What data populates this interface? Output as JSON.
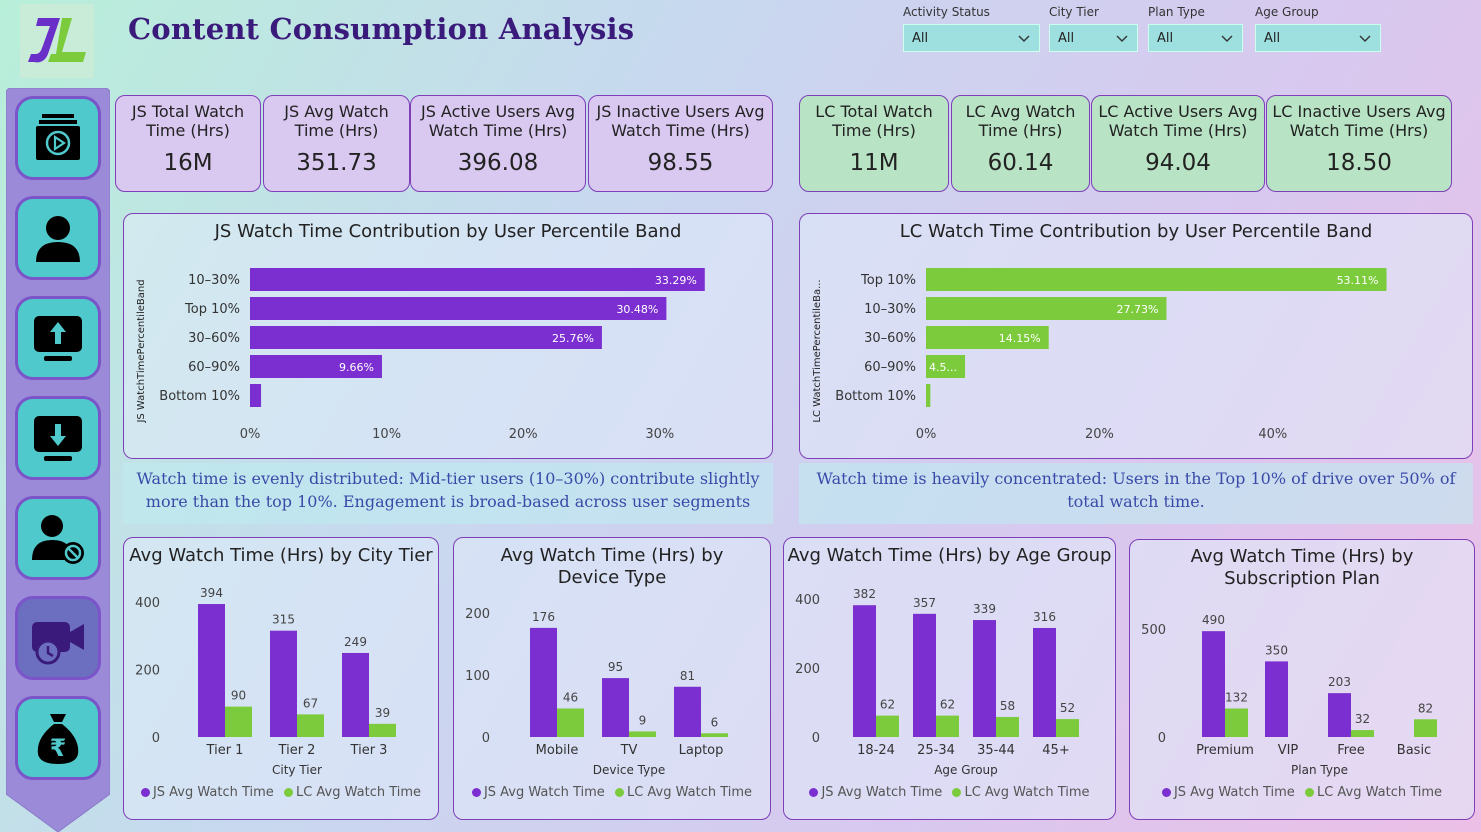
{
  "header": {
    "title": "Content Consumption Analysis",
    "logo_text": "JL"
  },
  "slicers": [
    {
      "label": "Activity Status",
      "value": "All"
    },
    {
      "label": "City Tier",
      "value": "All"
    },
    {
      "label": "Plan Type",
      "value": "All"
    },
    {
      "label": "Age Group",
      "value": "All"
    }
  ],
  "colors": {
    "js": "#7b2fd0",
    "lc": "#7ccb3c",
    "border": "#7e3fb8"
  },
  "sidebar": {
    "items": [
      {
        "icon": "content-play-icon"
      },
      {
        "icon": "user-icon"
      },
      {
        "icon": "upgrade-icon"
      },
      {
        "icon": "downgrade-icon"
      },
      {
        "icon": "inactive-user-icon"
      },
      {
        "icon": "watch-time-icon",
        "active": true
      },
      {
        "icon": "revenue-icon"
      }
    ]
  },
  "kpis_js": [
    {
      "title": "JS Total Watch Time (Hrs)",
      "value": "16M"
    },
    {
      "title": "JS Avg Watch Time (Hrs)",
      "value": "351.73"
    },
    {
      "title": "JS Active Users Avg Watch Time (Hrs)",
      "value": "396.08"
    },
    {
      "title": "JS Inactive Users Avg Watch Time (Hrs)",
      "value": "98.55"
    }
  ],
  "kpis_lc": [
    {
      "title": "LC Total Watch Time (Hrs)",
      "value": "11M"
    },
    {
      "title": "LC Avg Watch Time (Hrs)",
      "value": "60.14"
    },
    {
      "title": "LC Active Users Avg Watch Time (Hrs)",
      "value": "94.04"
    },
    {
      "title": "LC Inactive Users Avg Watch Time (Hrs)",
      "value": "18.50"
    }
  ],
  "notes": {
    "js": "Watch time is evenly distributed: Mid-tier users (10–30%) contribute slightly more than the top 10%. Engagement is broad-based across user segments",
    "lc": "Watch time is heavily concentrated: Users in the Top 10% of drive over 50% of total watch time."
  },
  "legend": {
    "js": "JS Avg Watch Time",
    "lc": "LC Avg Watch Time"
  },
  "chart_data": [
    {
      "type": "bar",
      "orientation": "horizontal",
      "title": "JS Watch Time Contribution by User Percentile Band",
      "ylabel": "JS WatchTimePercentileBand",
      "categories": [
        "10–30%",
        "Top 10%",
        "30–60%",
        "60–90%",
        "Bottom 10%"
      ],
      "values": [
        33.29,
        30.48,
        25.76,
        9.66,
        0.81
      ],
      "labels": [
        "33.29%",
        "30.48%",
        "25.76%",
        "9.66%",
        ""
      ],
      "xticks": [
        "0%",
        "10%",
        "20%",
        "30%"
      ],
      "xlim": [
        0,
        36.6
      ],
      "color": "#7b2fd0"
    },
    {
      "type": "bar",
      "orientation": "horizontal",
      "title": "LC Watch Time Contribution by User Percentile Band",
      "ylabel": "LC WatchTimePercentileBa...",
      "categories": [
        "Top 10%",
        "10–30%",
        "30–60%",
        "60–90%",
        "Bottom 10%"
      ],
      "values": [
        53.11,
        27.73,
        14.15,
        4.5,
        0.5
      ],
      "labels": [
        "53.11%",
        "27.73%",
        "14.15%",
        "4.5...",
        ""
      ],
      "xticks": [
        "0%",
        "20%",
        "40%"
      ],
      "xlim": [
        0,
        61.7
      ],
      "color": "#7ccb3c"
    },
    {
      "type": "bar",
      "title": "Avg Watch Time (Hrs) by City Tier",
      "xlabel": "City Tier",
      "categories": [
        "Tier 1",
        "Tier 2",
        "Tier 3"
      ],
      "series": [
        {
          "name": "JS Avg Watch Time",
          "values": [
            394,
            315,
            249
          ]
        },
        {
          "name": "LC Avg Watch Time",
          "values": [
            90,
            67,
            39
          ]
        }
      ],
      "yticks": [
        0,
        200,
        400
      ],
      "ylim": [
        0,
        400
      ]
    },
    {
      "type": "bar",
      "title": "Avg Watch Time (Hrs) by Device Type",
      "xlabel": "Device Type",
      "categories": [
        "Mobile",
        "TV",
        "Laptop"
      ],
      "series": [
        {
          "name": "JS Avg Watch Time",
          "values": [
            176,
            95,
            81
          ]
        },
        {
          "name": "LC Avg Watch Time",
          "values": [
            46,
            9,
            6
          ]
        }
      ],
      "yticks": [
        0,
        100,
        200
      ],
      "ylim": [
        0,
        200
      ]
    },
    {
      "type": "bar",
      "title": "Avg Watch Time (Hrs) by Age Group",
      "xlabel": "Age Group",
      "categories": [
        "18-24",
        "25-34",
        "35-44",
        "45+"
      ],
      "series": [
        {
          "name": "JS Avg Watch Time",
          "values": [
            382,
            357,
            339,
            316
          ]
        },
        {
          "name": "LC Avg Watch Time",
          "values": [
            62,
            62,
            58,
            52
          ]
        }
      ],
      "yticks": [
        0,
        200,
        400
      ],
      "ylim": [
        0,
        400
      ]
    },
    {
      "type": "bar",
      "title": "Avg Watch Time (Hrs) by Subscription Plan",
      "xlabel": "Plan Type",
      "categories": [
        "Premium",
        "VIP",
        "Free",
        "Basic"
      ],
      "series": [
        {
          "name": "JS Avg Watch Time",
          "values": [
            490,
            350,
            203,
            null
          ]
        },
        {
          "name": "LC Avg Watch Time",
          "values": [
            132,
            null,
            32,
            82
          ]
        }
      ],
      "yticks": [
        0,
        500
      ],
      "ylim": [
        0,
        500
      ]
    }
  ]
}
